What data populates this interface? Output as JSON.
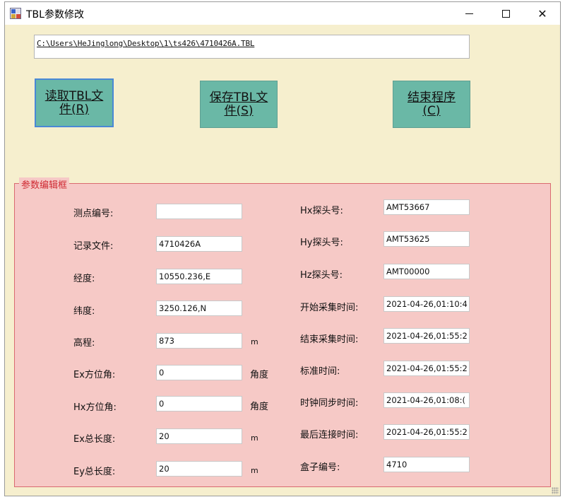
{
  "window": {
    "title": "TBL参数修改",
    "icon": "app-icon"
  },
  "title_controls": {
    "minimize": "minimize-icon",
    "maximize": "maximize-icon",
    "close": "✕"
  },
  "path": {
    "value": "C:\\Users\\HeJinglong\\Desktop\\1\\ts426\\4710426A.TBL"
  },
  "buttons": {
    "read_line1": "读取TBL文",
    "read_line2": "件(R)",
    "save_line1": "保存TBL文",
    "save_line2": "件(S)",
    "exit_line1": "结束程序",
    "exit_line2": "(C)"
  },
  "group": {
    "title": "参数编辑框",
    "left": [
      {
        "label": "测点编号:",
        "value": "",
        "unit": ""
      },
      {
        "label": "记录文件:",
        "value": "4710426A",
        "unit": ""
      },
      {
        "label": "经度:",
        "value": "10550.236,E",
        "unit": ""
      },
      {
        "label": "纬度:",
        "value": "3250.126,N",
        "unit": ""
      },
      {
        "label": "高程:",
        "value": "873",
        "unit": "m"
      },
      {
        "label": "Ex方位角:",
        "value": "0",
        "unit": "角度"
      },
      {
        "label": "Hx方位角:",
        "value": "0",
        "unit": "角度"
      },
      {
        "label": "Ex总长度:",
        "value": "20",
        "unit": "m"
      },
      {
        "label": "Ey总长度:",
        "value": "20",
        "unit": "m"
      }
    ],
    "right": [
      {
        "label": "Hx探头号:",
        "value": "AMT53667"
      },
      {
        "label": "Hy探头号:",
        "value": "AMT53625"
      },
      {
        "label": "Hz探头号:",
        "value": "AMT00000"
      },
      {
        "label": "开始采集时间:",
        "value": "2021-04-26,01:10:4"
      },
      {
        "label": "结束采集时间:",
        "value": "2021-04-26,01:55:2"
      },
      {
        "label": "标准时间:",
        "value": "2021-04-26,01:55:2"
      },
      {
        "label": "时钟同步时间:",
        "value": "2021-04-26,01:08:("
      },
      {
        "label": "最后连接时间:",
        "value": "2021-04-26,01:55:2"
      },
      {
        "label": "盒子编号:",
        "value": "4710"
      }
    ]
  }
}
